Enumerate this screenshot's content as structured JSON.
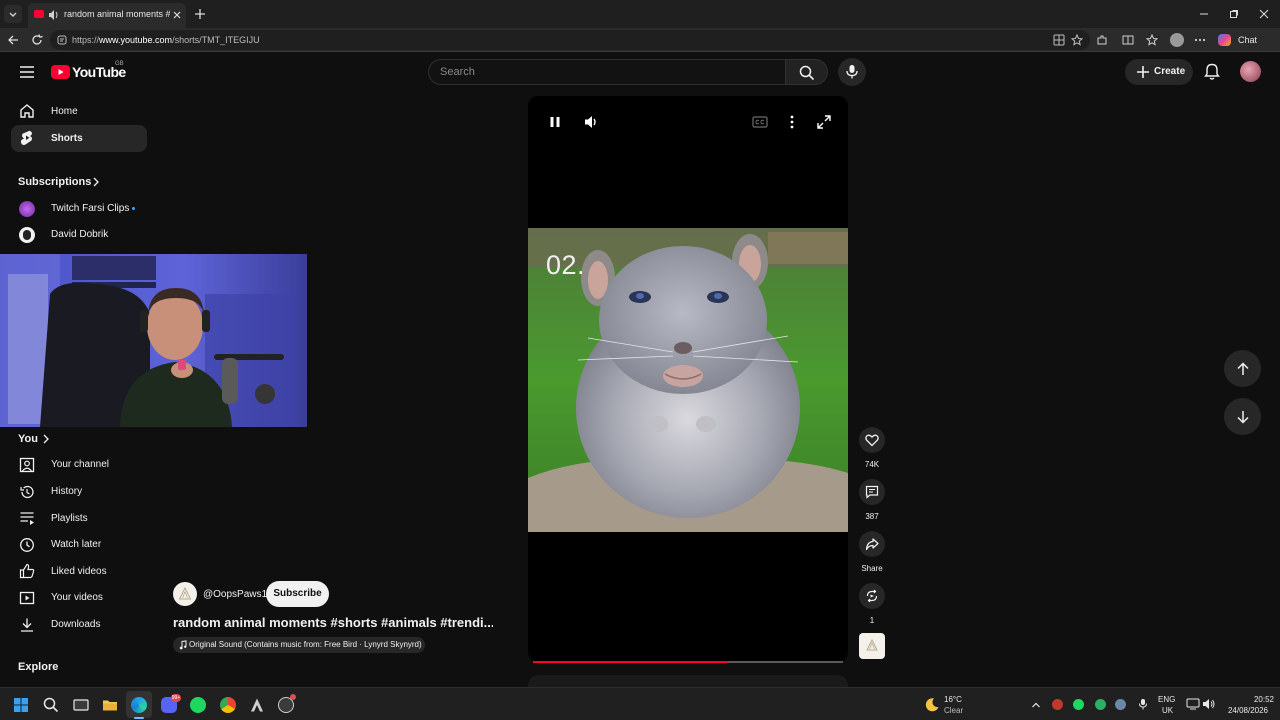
{
  "browser": {
    "tab_title": "random animal moments #shorts",
    "url_prefix": "https://",
    "url_host": "www.youtube.com",
    "url_path": "/shorts/TMT_ITEGIJU",
    "chat_label": "Chat"
  },
  "header": {
    "logo_text": "YouTube",
    "region": "GB",
    "search_placeholder": "Search",
    "create_label": "Create"
  },
  "sidebar": {
    "home": "Home",
    "shorts": "Shorts",
    "subscriptions_heading": "Subscriptions",
    "subscriptions": [
      "Twitch Farsi Clips",
      "David Dobrik"
    ],
    "you_heading": "You",
    "you_items": [
      "Your channel",
      "History",
      "Playlists",
      "Watch later",
      "Liked videos",
      "Your videos",
      "Downloads"
    ],
    "explore_heading": "Explore"
  },
  "video": {
    "overlay_text": "02.",
    "channel": "@OopsPaws1",
    "subscribe_label": "Subscribe",
    "title": "random animal moments #shorts #animals #trendi...",
    "sound": "Original Sound (Contains music from: Free Bird · Lynyrd Skynyrd)",
    "progress": 0.63
  },
  "actions": {
    "likes": "74K",
    "comments": "387",
    "share": "Share",
    "remix": "1"
  },
  "taskbar": {
    "weather_temp": "16°C",
    "weather_desc": "Clear",
    "lang": "ENG",
    "region": "UK",
    "time": "20:52",
    "date": "24/08/2026",
    "notification_count": "99+"
  },
  "colors": {
    "youtube_red": "#ff0033",
    "background": "#0f0f0f"
  }
}
